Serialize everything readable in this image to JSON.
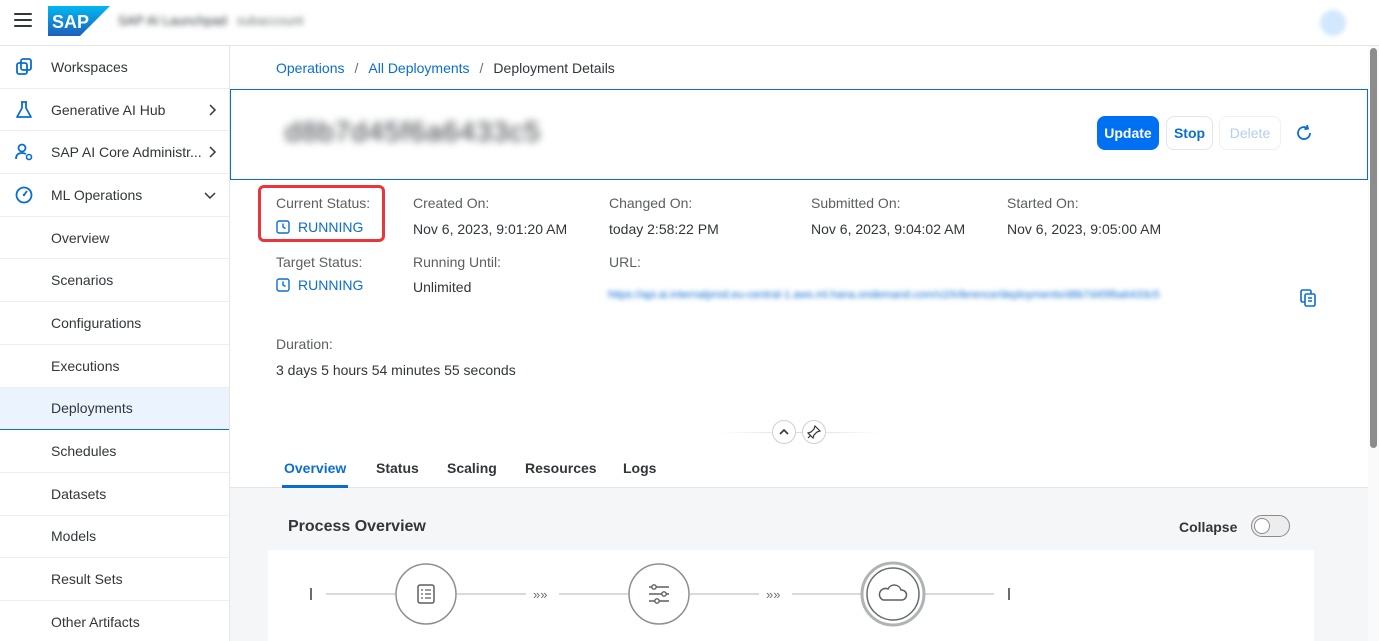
{
  "shell": {
    "logo_text": "SAP",
    "title": "SAP AI Launchpad",
    "subtitle": "subaccount"
  },
  "sidebar": {
    "items": [
      {
        "label": "Workspaces"
      },
      {
        "label": "Generative AI Hub"
      },
      {
        "label": "SAP AI Core Administr..."
      },
      {
        "label": "ML Operations"
      },
      {
        "label": "Overview"
      },
      {
        "label": "Scenarios"
      },
      {
        "label": "Configurations"
      },
      {
        "label": "Executions"
      },
      {
        "label": "Deployments"
      },
      {
        "label": "Schedules"
      },
      {
        "label": "Datasets"
      },
      {
        "label": "Models"
      },
      {
        "label": "Result Sets"
      },
      {
        "label": "Other Artifacts"
      }
    ]
  },
  "breadcrumb": {
    "items": [
      "Operations",
      "All Deployments"
    ],
    "current": "Deployment Details",
    "separator": "/"
  },
  "header": {
    "object_title": "d8b7d45f6a6433c5",
    "update_label": "Update",
    "stop_label": "Stop",
    "delete_label": "Delete"
  },
  "details": {
    "current_status_label": "Current Status:",
    "current_status_value": "RUNNING",
    "target_status_label": "Target Status:",
    "target_status_value": "RUNNING",
    "created_on_label": "Created On:",
    "created_on_value": "Nov 6, 2023, 9:01:20 AM",
    "running_until_label": "Running Until:",
    "running_until_value": "Unlimited",
    "changed_on_label": "Changed On:",
    "changed_on_value": "today 2:58:22 PM",
    "url_label": "URL:",
    "url_value": "https://api.ai.internalprod.eu-central-1.aws.ml.hana.ondemand.com/v2/inference/deployments/d8b7d45f6a6433c5",
    "submitted_on_label": "Submitted On:",
    "submitted_on_value": "Nov 6, 2023, 9:04:02 AM",
    "started_on_label": "Started On:",
    "started_on_value": "Nov 6, 2023, 9:05:00 AM",
    "duration_label": "Duration:",
    "duration_value": "3 days 5 hours 54 minutes 55 seconds"
  },
  "tabs": [
    "Overview",
    "Status",
    "Scaling",
    "Resources",
    "Logs"
  ],
  "process": {
    "title": "Process Overview",
    "collapse_label": "Collapse",
    "arrow_glyph": "»»"
  },
  "colors": {
    "accent": "#0a6ed1",
    "highlight": "#e8363b",
    "brand": "#0070f2"
  }
}
